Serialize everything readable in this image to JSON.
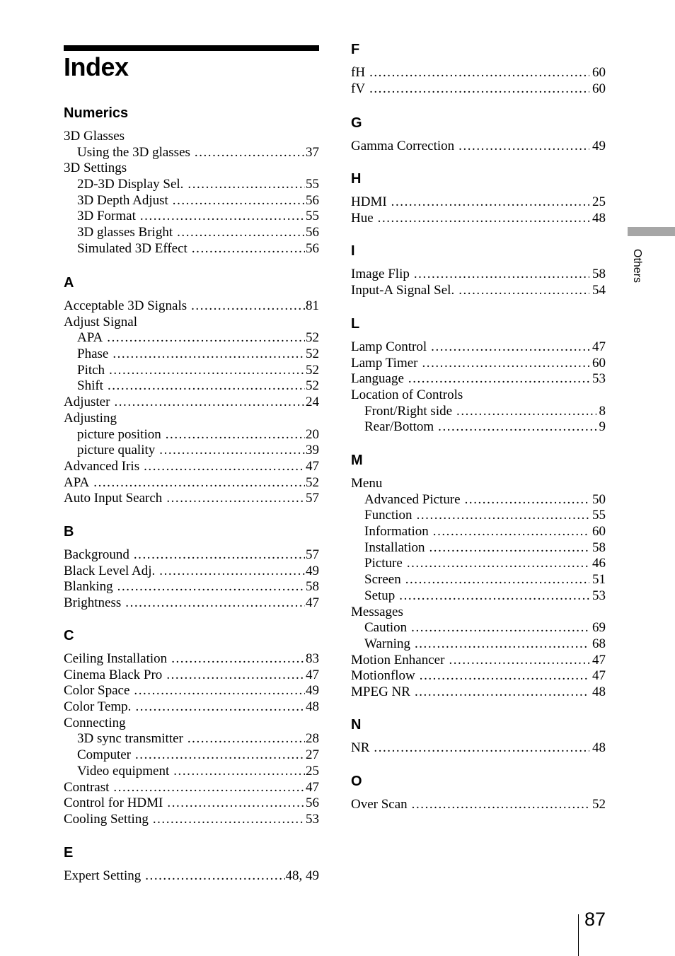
{
  "page": {
    "title": "Index",
    "side_tab_label": "Others",
    "page_number": "87"
  },
  "left_column": [
    {
      "heading": "Numerics",
      "entries": [
        {
          "term": "3D Glasses",
          "page": "",
          "level": 0
        },
        {
          "term": "Using the 3D glasses",
          "page": "37",
          "level": 1
        },
        {
          "term": "3D Settings",
          "page": "",
          "level": 0
        },
        {
          "term": "2D-3D Display Sel.",
          "page": "55",
          "level": 1
        },
        {
          "term": "3D Depth Adjust",
          "page": "56",
          "level": 1
        },
        {
          "term": "3D Format",
          "page": "55",
          "level": 1
        },
        {
          "term": "3D glasses Bright",
          "page": "56",
          "level": 1
        },
        {
          "term": "Simulated 3D Effect",
          "page": "56",
          "level": 1
        }
      ]
    },
    {
      "heading": "A",
      "entries": [
        {
          "term": "Acceptable 3D Signals",
          "page": "81",
          "level": 0
        },
        {
          "term": "Adjust Signal",
          "page": "",
          "level": 0
        },
        {
          "term": "APA",
          "page": "52",
          "level": 1
        },
        {
          "term": "Phase",
          "page": "52",
          "level": 1
        },
        {
          "term": "Pitch",
          "page": "52",
          "level": 1
        },
        {
          "term": "Shift",
          "page": "52",
          "level": 1
        },
        {
          "term": "Adjuster",
          "page": "24",
          "level": 0
        },
        {
          "term": "Adjusting",
          "page": "",
          "level": 0
        },
        {
          "term": "picture position",
          "page": "20",
          "level": 1
        },
        {
          "term": "picture quality",
          "page": "39",
          "level": 1
        },
        {
          "term": "Advanced Iris",
          "page": "47",
          "level": 0
        },
        {
          "term": "APA",
          "page": "52",
          "level": 0
        },
        {
          "term": "Auto Input Search",
          "page": "57",
          "level": 0
        }
      ]
    },
    {
      "heading": "B",
      "entries": [
        {
          "term": "Background",
          "page": "57",
          "level": 0
        },
        {
          "term": "Black Level Adj.",
          "page": "49",
          "level": 0
        },
        {
          "term": "Blanking",
          "page": "58",
          "level": 0
        },
        {
          "term": "Brightness",
          "page": "47",
          "level": 0
        }
      ]
    },
    {
      "heading": "C",
      "entries": [
        {
          "term": "Ceiling Installation",
          "page": "83",
          "level": 0
        },
        {
          "term": "Cinema Black Pro",
          "page": "47",
          "level": 0
        },
        {
          "term": "Color Space",
          "page": "49",
          "level": 0
        },
        {
          "term": "Color Temp.",
          "page": "48",
          "level": 0
        },
        {
          "term": "Connecting",
          "page": "",
          "level": 0
        },
        {
          "term": "3D sync transmitter",
          "page": "28",
          "level": 1
        },
        {
          "term": "Computer",
          "page": "27",
          "level": 1
        },
        {
          "term": "Video equipment",
          "page": "25",
          "level": 1
        },
        {
          "term": "Contrast",
          "page": "47",
          "level": 0
        },
        {
          "term": "Control for HDMI",
          "page": "56",
          "level": 0
        },
        {
          "term": "Cooling Setting",
          "page": "53",
          "level": 0
        }
      ]
    },
    {
      "heading": "E",
      "entries": [
        {
          "term": "Expert Setting",
          "page": "48, 49",
          "level": 0
        }
      ]
    }
  ],
  "right_column": [
    {
      "heading": "F",
      "entries": [
        {
          "term": "fH",
          "page": "60",
          "level": 0
        },
        {
          "term": "fV",
          "page": "60",
          "level": 0
        }
      ]
    },
    {
      "heading": "G",
      "entries": [
        {
          "term": "Gamma Correction",
          "page": "49",
          "level": 0
        }
      ]
    },
    {
      "heading": "H",
      "entries": [
        {
          "term": "HDMI",
          "page": "25",
          "level": 0
        },
        {
          "term": "Hue",
          "page": "48",
          "level": 0
        }
      ]
    },
    {
      "heading": "I",
      "entries": [
        {
          "term": "Image Flip",
          "page": "58",
          "level": 0
        },
        {
          "term": "Input-A Signal Sel.",
          "page": "54",
          "level": 0
        }
      ]
    },
    {
      "heading": "L",
      "entries": [
        {
          "term": "Lamp Control",
          "page": "47",
          "level": 0
        },
        {
          "term": "Lamp Timer",
          "page": "60",
          "level": 0
        },
        {
          "term": "Language",
          "page": "53",
          "level": 0
        },
        {
          "term": "Location of Controls",
          "page": "",
          "level": 0
        },
        {
          "term": "Front/Right side",
          "page": "8",
          "level": 1
        },
        {
          "term": "Rear/Bottom",
          "page": "9",
          "level": 1
        }
      ]
    },
    {
      "heading": "M",
      "entries": [
        {
          "term": "Menu",
          "page": "",
          "level": 0
        },
        {
          "term": "Advanced Picture",
          "page": "50",
          "level": 1
        },
        {
          "term": "Function",
          "page": "55",
          "level": 1
        },
        {
          "term": "Information",
          "page": "60",
          "level": 1
        },
        {
          "term": "Installation",
          "page": "58",
          "level": 1
        },
        {
          "term": "Picture",
          "page": "46",
          "level": 1
        },
        {
          "term": "Screen",
          "page": "51",
          "level": 1
        },
        {
          "term": "Setup",
          "page": "53",
          "level": 1
        },
        {
          "term": "Messages",
          "page": "",
          "level": 0
        },
        {
          "term": "Caution",
          "page": "69",
          "level": 1
        },
        {
          "term": "Warning",
          "page": "68",
          "level": 1
        },
        {
          "term": "Motion Enhancer",
          "page": "47",
          "level": 0
        },
        {
          "term": "Motionflow",
          "page": "47",
          "level": 0
        },
        {
          "term": "MPEG NR",
          "page": "48",
          "level": 0
        }
      ]
    },
    {
      "heading": "N",
      "entries": [
        {
          "term": "NR",
          "page": "48",
          "level": 0
        }
      ]
    },
    {
      "heading": "O",
      "entries": [
        {
          "term": "Over Scan",
          "page": "52",
          "level": 0
        }
      ]
    }
  ]
}
